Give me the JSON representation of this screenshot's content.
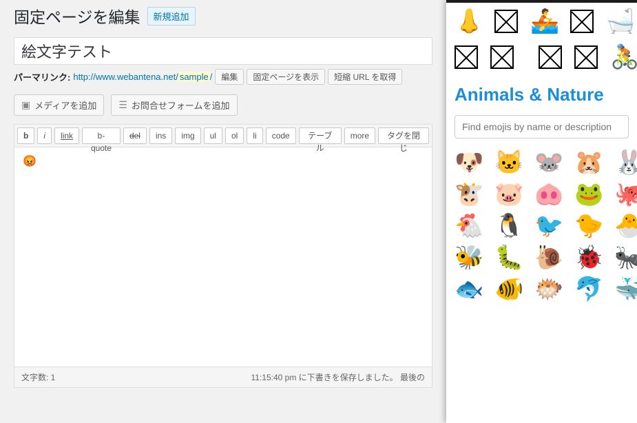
{
  "header": {
    "page_title": "固定ページを編集",
    "add_new_label": "新規追加"
  },
  "title_field": {
    "value": "絵文字テスト"
  },
  "permalink": {
    "label": "パーマリンク:",
    "base_url": "http://www.webantena.net/",
    "slug": "sample",
    "trailing": "/",
    "edit_label": "編集",
    "view_label": "固定ページを表示",
    "shorturl_label": "短縮 URL を取得"
  },
  "media_buttons": {
    "add_media": "メディアを追加",
    "add_form": "お問合せフォームを追加"
  },
  "toolbar": {
    "bold": "b",
    "italic": "i",
    "link": "link",
    "bquote": "b-quote",
    "del": "del",
    "ins": "ins",
    "img": "img",
    "ul": "ul",
    "ol": "ol",
    "li": "li",
    "code": "code",
    "table": "テーブル",
    "more": "more",
    "close_tags": "タグを閉じ"
  },
  "content": {
    "emoji": "😡"
  },
  "statusbar": {
    "wordcount_label": "文字数: ",
    "wordcount_value": "1",
    "save_message": "11:15:40 pm に下書きを保存しました。 最後の"
  },
  "emoji_panel": {
    "top_rows": [
      [
        "👃",
        "missing",
        "🚣",
        "missing",
        "🛁"
      ],
      [
        "missing",
        "missing",
        "",
        "missing",
        "missing",
        "🚴"
      ]
    ],
    "heading": "Animals & Nature",
    "search_placeholder": "Find emojis by name or description",
    "grid": [
      [
        "🐶",
        "🐱",
        "🐭",
        "🐹",
        "🐰"
      ],
      [
        "🐮",
        "🐷",
        "🐽",
        "🐸",
        "🐙"
      ],
      [
        "🐔",
        "🐧",
        "🐦",
        "🐤",
        "🐣"
      ],
      [
        "🐝",
        "🐛",
        "🐌",
        "🐞",
        "🐜"
      ],
      [
        "🐟",
        "🐠",
        "🐡",
        "🐬",
        "🐳"
      ]
    ]
  }
}
